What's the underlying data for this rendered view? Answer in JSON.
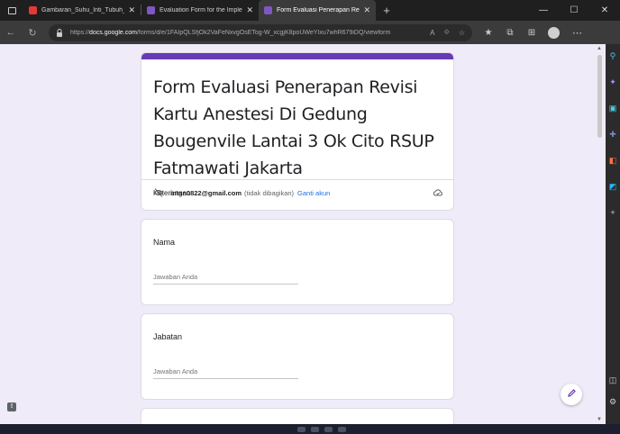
{
  "tabs": [
    {
      "title": "Gambaran_Suhu_Inti_Tubuh_Pa",
      "favicon_color": "#e53935",
      "active": false
    },
    {
      "title": "Evaluation Form for the Impleme",
      "favicon_color": "#7e57c2",
      "active": false
    },
    {
      "title": "Form Evaluasi Penerapan Revisi K",
      "favicon_color": "#7e57c2",
      "active": true
    }
  ],
  "address_bar": {
    "url_prefix": "https://",
    "url_host": "docs.google.com",
    "url_path": "/forms/d/e/1FAIpQLSfjOk2VaFeNxvgOsETog-W_xcgjK8poUWeYIxu7whR679iDQ/viewform"
  },
  "form": {
    "accent_color": "#673ab7",
    "title": "Form Evaluasi Penerapan Revisi Kartu Anestesi Di Gedung Bougenvile Lantai 3 Ok Cito RSUP Fatmawati Jakarta",
    "description": "Keterangan",
    "account": {
      "email": "intan0822@gmail.com",
      "note": "(tidak dibagikan)",
      "switch_label": "Ganti akun"
    },
    "questions": [
      {
        "label": "Nama",
        "placeholder": "Jawaban Anda"
      },
      {
        "label": "Jabatan",
        "placeholder": "Jawaban Anda"
      }
    ]
  },
  "icons": {
    "back": "back-arrow-icon",
    "refresh": "refresh-icon",
    "lock": "lock-icon",
    "edit": "pencil-icon",
    "hidden": "eye-off-icon",
    "cloud": "cloud-save-icon"
  }
}
